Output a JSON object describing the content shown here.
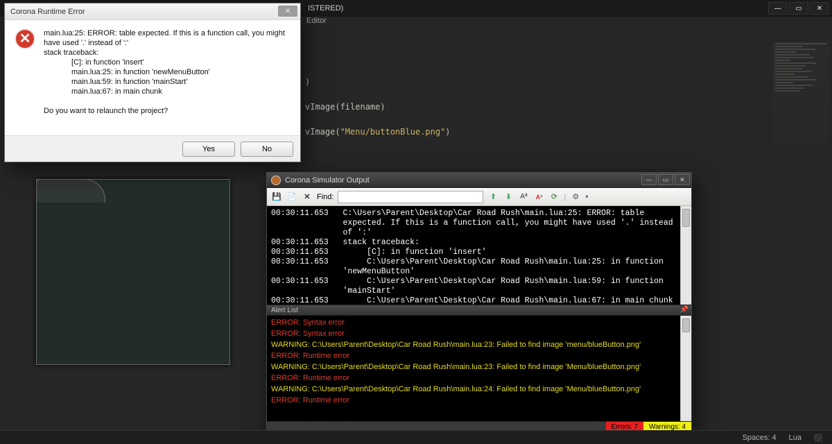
{
  "editor": {
    "title_suffix": "ISTERED)",
    "subtitle": "Editor",
    "code_line1": ")",
    "code_line2_pre": "vImage(filename)",
    "code_line3_pre": "vImage(",
    "code_line3_str": "\"Menu/buttonBlue.png\"",
    "code_line3_post": ")"
  },
  "dialog": {
    "title": "Corona Runtime Error",
    "line1": "main.lua:25: ERROR: table expected. If this is a function call, you might",
    "line2": "have used '.' instead of ':'",
    "line3": "stack traceback:",
    "tb1": "[C]: in function 'insert'",
    "tb2": "main.lua:25: in function 'newMenuButton'",
    "tb3": "main.lua:59: in function 'mainStart'",
    "tb4": "main.lua:67: in main chunk",
    "relaunch": "Do you want to relaunch the project?",
    "yes": "Yes",
    "no": "No"
  },
  "output": {
    "title": "Corona Simulator Output",
    "find_label": "Find:",
    "console_text": "00:30:11.653   C:\\Users\\Parent\\Desktop\\Car Road Rush\\main.lua:25: ERROR: table\n               expected. If this is a function call, you might have used '.' instead\n               of ':'\n00:30:11.653   stack traceback:\n00:30:11.653        [C]: in function 'insert'\n00:30:11.653        C:\\Users\\Parent\\Desktop\\Car Road Rush\\main.lua:25: in function\n               'newMenuButton'\n00:30:11.653        C:\\Users\\Parent\\Desktop\\Car Road Rush\\main.lua:59: in function\n               'mainStart'\n00:30:11.653        C:\\Users\\Parent\\Desktop\\Car Road Rush\\main.lua:67: in main chunk",
    "alert_header": "Alert List",
    "alerts": {
      "a1": "ERROR: Syntax error",
      "a2": "ERROR: Syntax error",
      "a3": "WARNING: C:\\Users\\Parent\\Desktop\\Car Road Rush\\main.lua:23: Failed to find image 'menu/blueButton.png'",
      "a4": "ERROR: Runtime error",
      "a5": "WARNING: C:\\Users\\Parent\\Desktop\\Car Road Rush\\main.lua:23: Failed to find image 'Menu/blueButton.png'",
      "a6": "ERROR: Runtime error",
      "a7": "WARNING: C:\\Users\\Parent\\Desktop\\Car Road Rush\\main.lua:24: Failed to find image 'Menu/blueButton.png'",
      "a8": "ERROR: Runtime error"
    },
    "errors_label": "Errors: 7",
    "warnings_label": "Warnings: 4"
  },
  "status": {
    "spaces": "Spaces: 4",
    "lang": "Lua"
  }
}
